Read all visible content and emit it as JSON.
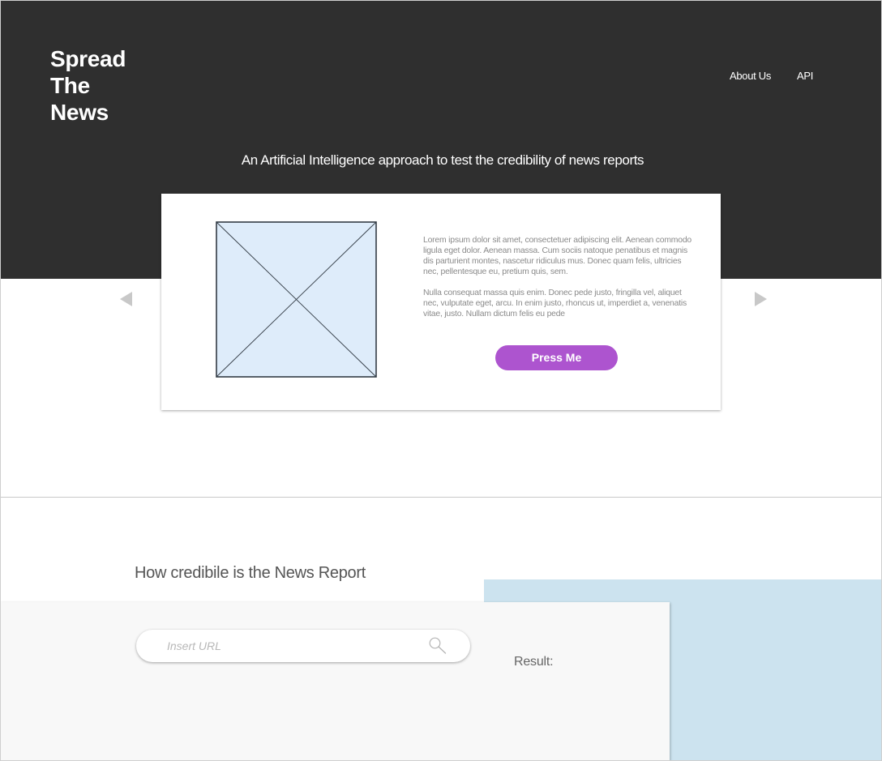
{
  "header": {
    "logo_lines": [
      "Spread",
      "The",
      "News"
    ],
    "nav": {
      "about": "About Us",
      "api": "API"
    },
    "tagline": "An Artificial Intelligence approach to test the credibility of news reports"
  },
  "carousel": {
    "paragraphs": [
      "Lorem ipsum dolor sit amet, consectetuer adipiscing elit. Aenean commodo ligula eget dolor. Aenean massa. Cum sociis natoque penatibus et magnis dis parturient montes, nascetur ridiculus mus. Donec quam felis, ultricies nec, pellentesque eu, pretium quis, sem.",
      "Nulla consequat massa quis enim. Donec pede justo, fringilla vel, aliquet nec, vulputate eget, arcu. In enim justo, rhoncus ut, imperdiet a, venenatis vitae, justo. Nullam dictum felis eu pede"
    ],
    "button_label": "Press Me",
    "prev_icon": "triangle-left-icon",
    "next_icon": "triangle-right-icon"
  },
  "checker": {
    "heading": "How credibile is the News Report",
    "search_placeholder": "Insert URL",
    "search_value": "",
    "search_icon": "magnifier-icon",
    "result_label": "Result:"
  },
  "colors": {
    "header_bg": "#2f2f2f",
    "button_bg": "#ad54cf",
    "image_placeholder_bg": "#deecfa",
    "result_panel_bg": "#cce3ef",
    "input_panel_bg": "#f8f8f8"
  }
}
